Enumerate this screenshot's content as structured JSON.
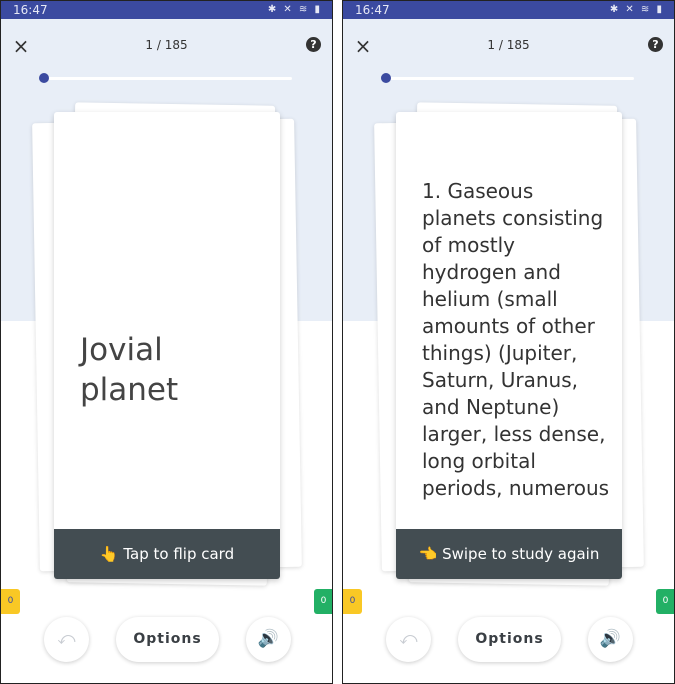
{
  "status": {
    "time": "16:47",
    "icons": "✱ ✕ ≋ ▮"
  },
  "header": {
    "close_icon": "×",
    "counter": "1 / 185",
    "help_icon": "?"
  },
  "progress": {
    "value": 1,
    "total": 185
  },
  "left": {
    "term": "Jovial planet",
    "footer": "👆 Tap to flip card"
  },
  "right": {
    "definition": "1. Gaseous planets consisting of mostly hydrogen and helium (small amounts of other things) (Jupiter, Saturn, Uranus, and Neptune) larger, less dense, long orbital periods, numerous",
    "footer": "👈 Swipe to study again"
  },
  "badges": {
    "still_learning": "0",
    "known": "0"
  },
  "buttons": {
    "undo": "⤺",
    "options": "Options",
    "sound": "🔊"
  },
  "colors": {
    "status_bar": "#3b4aa0",
    "badge_yellow": "#f9c825",
    "badge_green": "#22b065",
    "card_footer": "#434d52"
  }
}
